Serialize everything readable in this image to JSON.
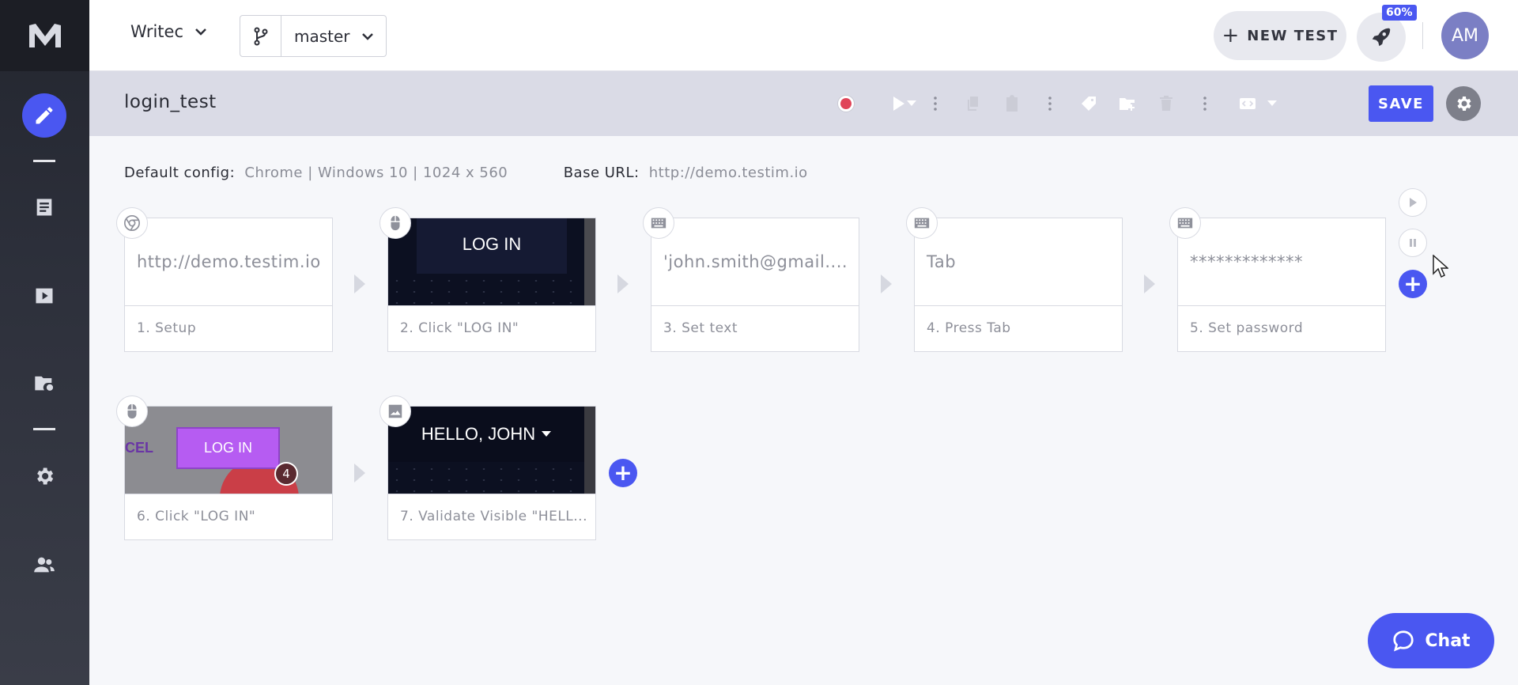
{
  "topbar": {
    "project_name": "Writec",
    "branch": "master",
    "new_test_label": "NEW TEST",
    "progress_badge": "60%",
    "avatar_initials": "AM"
  },
  "titlebar": {
    "test_name": "login_test",
    "save_label": "SAVE"
  },
  "config": {
    "default_label": "Default config:",
    "default_value": "Chrome | Windows 10 | 1024 x 560",
    "base_url_label": "Base URL:",
    "base_url_value": "http://demo.testim.io"
  },
  "steps": [
    {
      "label": "1. Setup",
      "content": "http://demo.testim.io",
      "icon": "chrome-icon"
    },
    {
      "label": "2. Click \"LOG IN\"",
      "content": "LOG IN",
      "icon": "mouse-icon"
    },
    {
      "label": "3. Set text",
      "content": "'john.smith@gmail....",
      "icon": "keyboard-icon"
    },
    {
      "label": "4. Press Tab",
      "content": "Tab",
      "icon": "keyboard-icon"
    },
    {
      "label": "5. Set password",
      "content": "*************",
      "icon": "keyboard-icon"
    },
    {
      "label": "6. Click \"LOG IN\"",
      "content": "LOG IN",
      "content_left": "CEL",
      "step_num": "4",
      "icon": "mouse-icon"
    },
    {
      "label": "7. Validate Visible \"HELL...",
      "content": "HELLO, JOHN",
      "icon": "image-icon"
    }
  ],
  "chat": {
    "label": "Chat"
  },
  "colors": {
    "accent": "#4a57f1",
    "record": "#e04459",
    "sidebar": "#2d303b"
  }
}
